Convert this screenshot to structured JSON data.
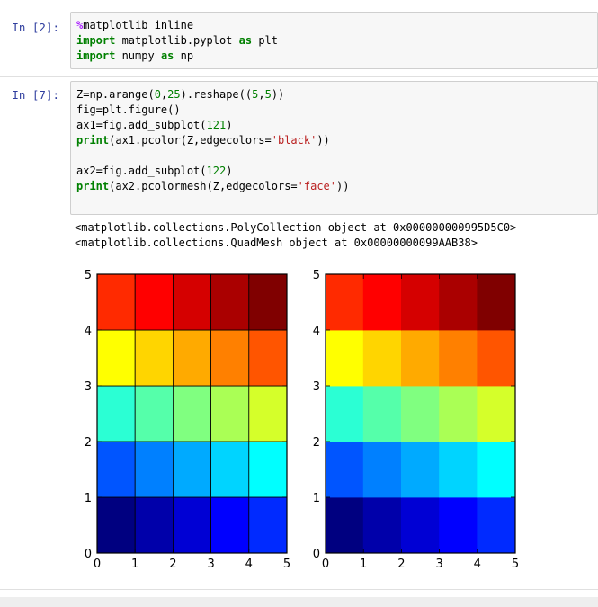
{
  "cells": [
    {
      "prompt": "In [2]:",
      "code_tokens": [
        [
          {
            "t": "%",
            "c": "mg"
          },
          {
            "t": "matplotlib inline"
          }
        ],
        [
          {
            "t": "import",
            "c": "kw"
          },
          {
            "t": " matplotlib.pyplot "
          },
          {
            "t": "as",
            "c": "kw"
          },
          {
            "t": " plt"
          }
        ],
        [
          {
            "t": "import",
            "c": "kw"
          },
          {
            "t": " numpy "
          },
          {
            "t": "as",
            "c": "kw"
          },
          {
            "t": " np"
          }
        ]
      ]
    },
    {
      "prompt": "In [7]:",
      "code_tokens": [
        [
          {
            "t": "Z=np.arange("
          },
          {
            "t": "0",
            "c": "num"
          },
          {
            "t": ","
          },
          {
            "t": "25",
            "c": "num"
          },
          {
            "t": ").reshape(("
          },
          {
            "t": "5",
            "c": "num"
          },
          {
            "t": ","
          },
          {
            "t": "5",
            "c": "num"
          },
          {
            "t": "))"
          }
        ],
        [
          {
            "t": "fig=plt.figure()"
          }
        ],
        [
          {
            "t": "ax1=fig.add_subplot("
          },
          {
            "t": "121",
            "c": "num"
          },
          {
            "t": ")"
          }
        ],
        [
          {
            "t": "print",
            "c": "kw"
          },
          {
            "t": "(ax1.pcolor(Z,edgecolors="
          },
          {
            "t": "'black'",
            "c": "str"
          },
          {
            "t": "))"
          }
        ],
        [
          {
            "t": ""
          }
        ],
        [
          {
            "t": "ax2=fig.add_subplot("
          },
          {
            "t": "122",
            "c": "num"
          },
          {
            "t": ")"
          }
        ],
        [
          {
            "t": "print",
            "c": "kw"
          },
          {
            "t": "(ax2.pcolormesh(Z,edgecolors="
          },
          {
            "t": "'face'",
            "c": "str"
          },
          {
            "t": "))"
          }
        ]
      ]
    }
  ],
  "output_lines": [
    "<matplotlib.collections.PolyCollection object at 0x000000000995D5C0>",
    "<matplotlib.collections.QuadMesh object at 0x00000000099AAB38>"
  ],
  "chart_data": [
    {
      "type": "heatmap",
      "title": "",
      "xlabel": "",
      "ylabel": "",
      "xlim": [
        0,
        5
      ],
      "ylim": [
        0,
        5
      ],
      "xticks": [
        "0",
        "1",
        "2",
        "3",
        "4",
        "5"
      ],
      "yticks": [
        "0",
        "1",
        "2",
        "3",
        "4",
        "5"
      ],
      "edgecolors": "black",
      "colormap": "jet",
      "z": [
        [
          0,
          1,
          2,
          3,
          4
        ],
        [
          5,
          6,
          7,
          8,
          9
        ],
        [
          10,
          11,
          12,
          13,
          14
        ],
        [
          15,
          16,
          17,
          18,
          19
        ],
        [
          20,
          21,
          22,
          23,
          24
        ]
      ]
    },
    {
      "type": "heatmap",
      "title": "",
      "xlabel": "",
      "ylabel": "",
      "xlim": [
        0,
        5
      ],
      "ylim": [
        0,
        5
      ],
      "xticks": [
        "0",
        "1",
        "2",
        "3",
        "4",
        "5"
      ],
      "yticks": [
        "0",
        "1",
        "2",
        "3",
        "4",
        "5"
      ],
      "edgecolors": "face",
      "colormap": "jet",
      "z": [
        [
          0,
          1,
          2,
          3,
          4
        ],
        [
          5,
          6,
          7,
          8,
          9
        ],
        [
          10,
          11,
          12,
          13,
          14
        ],
        [
          15,
          16,
          17,
          18,
          19
        ],
        [
          20,
          21,
          22,
          23,
          24
        ]
      ]
    }
  ]
}
